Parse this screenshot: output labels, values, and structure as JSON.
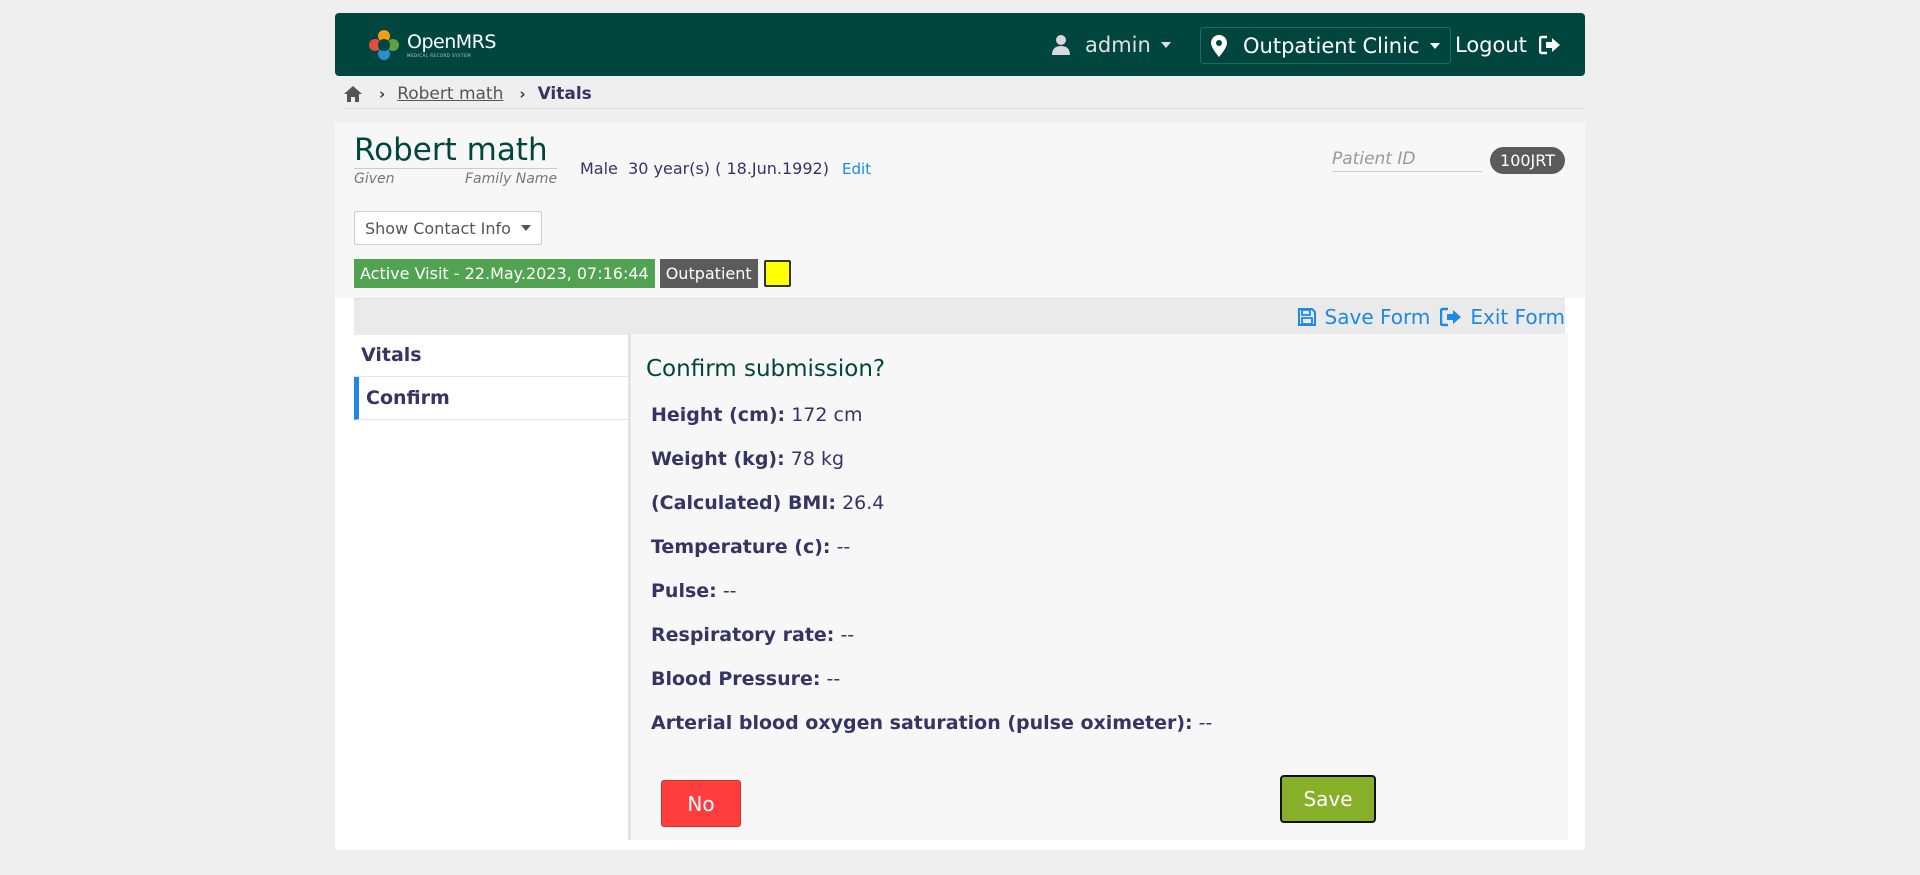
{
  "header": {
    "logo_name": "OpenMRS",
    "logo_tagline": "MEDICAL RECORD SYSTEM",
    "user": "admin",
    "location": "Outpatient Clinic",
    "logout": "Logout"
  },
  "breadcrumb": {
    "patient": "Robert math",
    "current": "Vitals"
  },
  "patient": {
    "name": "Robert math",
    "given_label": "Given",
    "family_label": "Family Name",
    "gender": "Male",
    "age": "30 year(s) ( 18.Jun.1992)",
    "edit": "Edit",
    "id_label": "Patient ID",
    "id_value": "100JRT",
    "contact_button": "Show Contact Info",
    "visit_active": "Active Visit - 22.May.2023, 07:16:44",
    "visit_type": "Outpatient"
  },
  "form": {
    "save_form": "Save Form",
    "exit_form": "Exit Form",
    "nav": [
      "Vitals",
      "Confirm"
    ],
    "confirm_title": "Confirm submission?",
    "fields": [
      {
        "label": "Height (cm):",
        "value": "172 cm"
      },
      {
        "label": "Weight (kg):",
        "value": "78 kg"
      },
      {
        "label": "(Calculated) BMI:",
        "value": "26.4"
      },
      {
        "label": "Temperature (c):",
        "value": "--"
      },
      {
        "label": "Pulse:",
        "value": "--"
      },
      {
        "label": "Respiratory rate:",
        "value": "--"
      },
      {
        "label": "Blood Pressure:",
        "value": "--"
      },
      {
        "label": "Arterial blood oxygen saturation (pulse oximeter):",
        "value": "--"
      }
    ],
    "no_button": "No",
    "save_button": "Save"
  },
  "colors": {
    "header_bg": "#00463f",
    "link": "#1e88e5",
    "active_visit": "#51a351",
    "no_button": "#ff3d3d",
    "save_button": "#88af28"
  }
}
